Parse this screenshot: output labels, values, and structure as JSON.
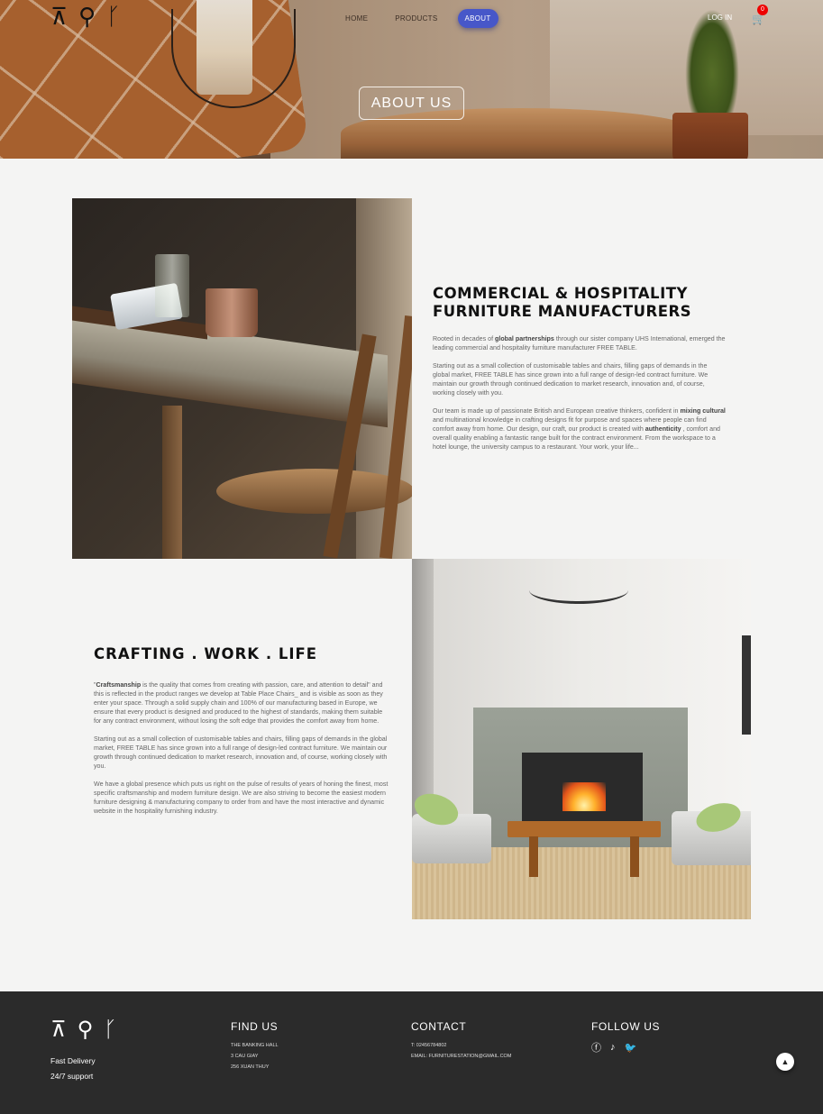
{
  "brand": {
    "logo_glyphs": [
      "⊼",
      "⚲",
      "ᚴ"
    ]
  },
  "nav": {
    "items": [
      {
        "label": "HOME"
      },
      {
        "label": "PRODUCTS"
      },
      {
        "label": "ABOUT"
      }
    ],
    "active": "ABOUT",
    "login": "LOG IN",
    "cart_count": "0",
    "accent_color": "#4757c9"
  },
  "hero": {
    "button": "ABOUT US"
  },
  "section1": {
    "title_line1": "COMMERCIAL & HOSPITALITY",
    "title_line2": "FURNITURE MANUFACTURERS",
    "p1_a": "Rooted in decades of ",
    "p1_b": "global partnerships",
    "p1_c": " through our sister company UHS International, emerged the leading commercial and hospitality furniture manufacturer FREE TABLE.",
    "p2": "Starting out as a small collection of customisable tables and chairs, filling gaps of demands in the global market, FREE TABLE has since grown into a full range of design-led contract furniture. We maintain our growth through continued dedication to market research, innovation and, of course, working closely with you.",
    "p3_a": "Our team is made up of passionate British and European creative thinkers, confident in ",
    "p3_b": "mixing cultural",
    "p3_c": " and multinational knowledge in crafting designs fit for purpose and spaces where people can find comfort away from home. Our design, our craft, our product is created with ",
    "p3_d": "authenticity",
    "p3_e": " , comfort and overall quality enabling a fantastic range built for the contract environment. From the workspace to a hotel lounge, the university campus to a restaurant. Your work, your life..."
  },
  "section2": {
    "title": "CRAFTING . WORK . LIFE",
    "p1_a": "\"",
    "p1_b": "Craftsmanship",
    "p1_c": " is the quality that comes from creating with passion, care, and attention to detail\" and this is reflected in the product ranges we develop at Table Place Chairs_ and is visible as soon as they enter your space. Through a solid supply chain and 100% of our manufacturing based in Europe, we ensure that every product is designed and produced to the highest of standards, making them suitable for any contract environment, without losing the soft edge that provides the comfort away from home.",
    "p2": "Starting out as a small collection of customisable tables and chairs, filling gaps of demands in the global market, FREE TABLE has since grown into a full range of design-led contract furniture. We maintain our growth through continued dedication to market research, innovation and, of course, working closely with you.",
    "p3": "We have a global presence which puts us right on the pulse of results of years of honing the finest, most specific craftsmanship and modern furniture design. We are also striving to become the easiest modern furniture designing & manufacturing company to order from and have the most interactive and dynamic website in the hospitality furnishing industry."
  },
  "footer": {
    "tagline1": "Fast Delivery",
    "tagline2": "24/7 support",
    "find_us": {
      "title": "FIND US",
      "lines": [
        "THE BANKING HALL",
        "3 CAU GIAY",
        "256 XUAN THUY"
      ]
    },
    "contact": {
      "title": "CONTACT",
      "phone": "T: 02456784802",
      "email": "EMAIL: FURNITURESTATION@GMAIL.COM"
    },
    "follow": {
      "title": "FOLLOW US",
      "icons": [
        "facebook-icon",
        "tiktok-icon",
        "twitter-icon"
      ]
    }
  }
}
